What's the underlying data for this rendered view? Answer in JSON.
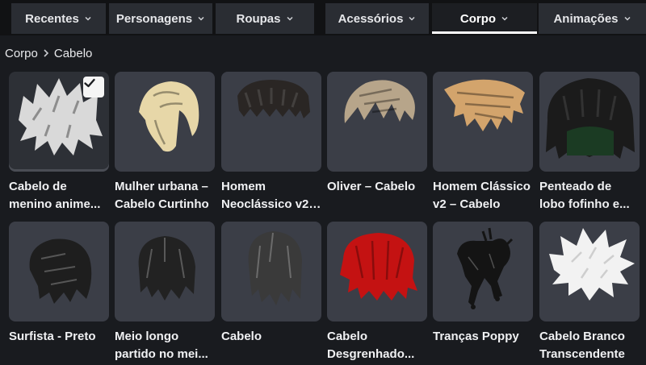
{
  "tabs": [
    {
      "label": "Recentes",
      "active": false
    },
    {
      "label": "Personagens",
      "active": false
    },
    {
      "label": "Roupas",
      "active": false
    },
    {
      "label": "Acessórios",
      "active": false
    },
    {
      "label": "Corpo",
      "active": true
    },
    {
      "label": "Animações",
      "active": false
    }
  ],
  "breadcrumb": {
    "root": "Corpo",
    "current": "Cabelo"
  },
  "items": [
    {
      "name": "Cabelo de menino anime...",
      "selected": true,
      "icon": "spiky-gray-hair-icon",
      "color": "#d9d9d9"
    },
    {
      "name": "Mulher urbana – Cabelo Curtinho",
      "selected": false,
      "icon": "blonde-bob-hair-icon",
      "color": "#e7d7a8"
    },
    {
      "name": "Homem Neoclássico v2 ...",
      "selected": false,
      "icon": "dark-textured-hair-icon",
      "color": "#2a2624"
    },
    {
      "name": "Oliver – Cabelo",
      "selected": false,
      "icon": "ash-brown-swept-hair-icon",
      "color": "#b7a58a"
    },
    {
      "name": "Homem Clássico v2 – Cabelo",
      "selected": false,
      "icon": "light-brown-swept-hair-icon",
      "color": "#d3a46c"
    },
    {
      "name": "Penteado de lobo fofinho e...",
      "selected": false,
      "icon": "black-wolfcut-hair-icon",
      "color": "#1b1b1b"
    },
    {
      "name": "Surfista - Preto",
      "selected": false,
      "icon": "black-surfer-hair-icon",
      "color": "#1e1e1e"
    },
    {
      "name": "Meio longo partido no mei...",
      "selected": false,
      "icon": "black-middle-part-hair-icon",
      "color": "#222222"
    },
    {
      "name": "Cabelo",
      "selected": false,
      "icon": "dark-gray-hair-icon",
      "color": "#3a3a3a"
    },
    {
      "name": "Cabelo Desgrenhado...",
      "selected": false,
      "icon": "red-messy-hair-icon",
      "color": "#c41212"
    },
    {
      "name": "Tranças Poppy",
      "selected": false,
      "icon": "black-braids-hair-icon",
      "color": "#141414"
    },
    {
      "name": "Cabelo Branco Transcendente",
      "selected": false,
      "icon": "white-spiky-hair-icon",
      "color": "#f2f2f2"
    }
  ],
  "colors": {
    "background": "#191b1f",
    "tab_bg": "#2a2d33",
    "tile_bg": "#3b3e47",
    "active_underline": "#ffffff"
  }
}
